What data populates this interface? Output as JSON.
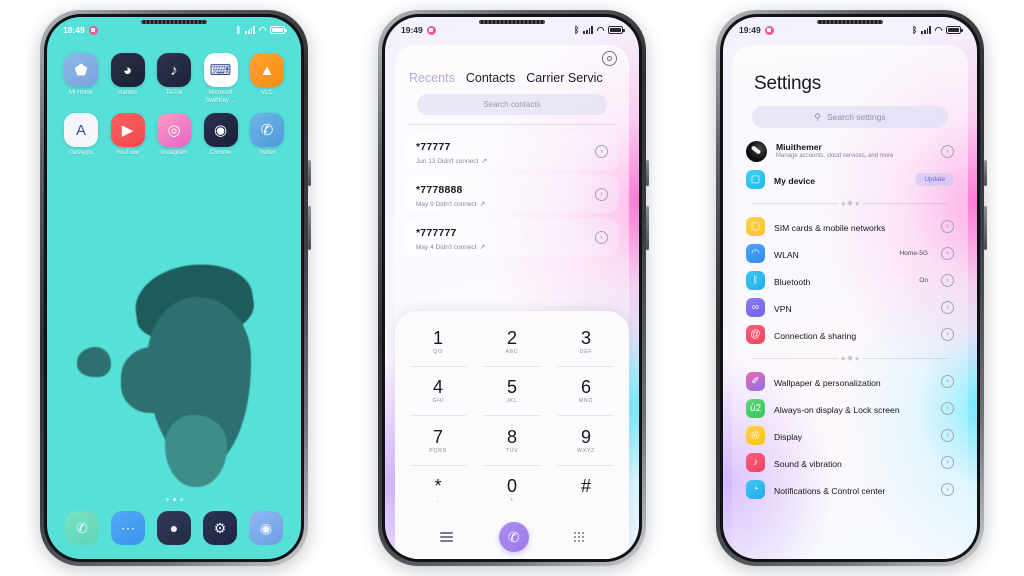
{
  "statusbar": {
    "time": "19:49",
    "icons": [
      "bluetooth-icon",
      "signal-icon",
      "wifi-icon",
      "battery-icon"
    ],
    "bluetooth_glyph": "ᛒ",
    "wifi_glyph": "◠"
  },
  "phone1": {
    "name": "home-screen",
    "wallpaper_color": "#56e0d8",
    "apps_row1": [
      {
        "label": "Mi Home",
        "icon": "mi-home-icon",
        "bg": "linear-gradient(145deg,#8fb8e8,#7aa3dd)",
        "glyph": "⬟"
      },
      {
        "label": "Games",
        "icon": "games-icon",
        "bg": "linear-gradient(145deg,#2c3147,#1b2033)",
        "glyph": "◕"
      },
      {
        "label": "TikTok",
        "icon": "tiktok-icon",
        "bg": "linear-gradient(145deg,#2e3450,#1d2238)",
        "glyph": "♪"
      },
      {
        "label": "Microsoft SwiftKey ...",
        "icon": "swiftkey-icon",
        "bg": "#ffffff",
        "glyph": "⌨"
      },
      {
        "label": "VLC",
        "icon": "vlc-icon",
        "bg": "linear-gradient(145deg,#ffa32e,#f98d16)",
        "glyph": "▲"
      }
    ],
    "apps_row2": [
      {
        "label": "GetApps",
        "icon": "getapps-icon",
        "bg": "#f4f6fb",
        "glyph": "A"
      },
      {
        "label": "YouTube",
        "icon": "youtube-icon",
        "bg": "linear-gradient(145deg,#f9625f,#ef4b4b)",
        "glyph": "▶"
      },
      {
        "label": "Instagram",
        "icon": "instagram-icon",
        "bg": "linear-gradient(145deg,#f9a0c0,#e862c8)",
        "glyph": "◎"
      },
      {
        "label": "Chrome",
        "icon": "chrome-icon",
        "bg": "linear-gradient(145deg,#2b3150,#1a2038)",
        "glyph": "◉"
      },
      {
        "label": "Twitter",
        "icon": "twitter-icon",
        "bg": "linear-gradient(145deg,#6fb4e8,#4e9ad9)",
        "glyph": "✆"
      }
    ],
    "page_dots": {
      "count": 3,
      "active_index": 1
    },
    "dock": [
      {
        "icon": "phone-dock-icon",
        "bg": "linear-gradient(145deg,#7ae2c4,#5fd4b5)",
        "glyph": "✆"
      },
      {
        "icon": "messages-dock-icon",
        "bg": "linear-gradient(145deg,#55a8f5,#3a93ec)",
        "glyph": "⋯"
      },
      {
        "icon": "camera-dock-icon",
        "bg": "linear-gradient(145deg,#333a58,#242a44)",
        "glyph": "●"
      },
      {
        "icon": "settings-dock-icon",
        "bg": "linear-gradient(145deg,#2c3353,#1e2440)",
        "glyph": "⚙"
      },
      {
        "icon": "browser-dock-icon",
        "bg": "linear-gradient(145deg,#8fb8f0,#6f9ee4)",
        "glyph": "◉"
      }
    ]
  },
  "phone2": {
    "name": "dialer-screen",
    "tabs": [
      {
        "label": "Recents",
        "active": true
      },
      {
        "label": "Contacts",
        "active": false
      },
      {
        "label": "Carrier Servic",
        "active": false
      }
    ],
    "search_placeholder": "Search contacts",
    "top_icon": "target-icon",
    "calls": [
      {
        "number": "*77777",
        "detail": "Jun 13 Didn't connect",
        "direction": "outgoing"
      },
      {
        "number": "*7778888",
        "detail": "May 9 Didn't connect",
        "direction": "outgoing"
      },
      {
        "number": "*777777",
        "detail": "May 4 Didn't connect",
        "direction": "outgoing"
      }
    ],
    "keypad": [
      {
        "num": "1",
        "letters": "QO"
      },
      {
        "num": "2",
        "letters": "ABC"
      },
      {
        "num": "3",
        "letters": "DEF"
      },
      {
        "num": "4",
        "letters": "GHI"
      },
      {
        "num": "5",
        "letters": "JKL"
      },
      {
        "num": "6",
        "letters": "MNO"
      },
      {
        "num": "7",
        "letters": "PQRS"
      },
      {
        "num": "8",
        "letters": "TUV"
      },
      {
        "num": "9",
        "letters": "WXYZ"
      },
      {
        "num": "*",
        "letters": ","
      },
      {
        "num": "0",
        "letters": "+"
      },
      {
        "num": "#",
        "letters": ""
      }
    ],
    "bottom_bar": {
      "menu_icon": "menu-icon",
      "call_icon": "call-icon",
      "call_glyph": "✆",
      "keypad_icon": "keypad-icon",
      "call_button_color": "#a184ec"
    }
  },
  "phone3": {
    "name": "settings-screen",
    "title": "Settings",
    "search_placeholder": "Search settings",
    "account": {
      "name": "Miuithemer",
      "subtitle": "Manage accounts, cloud services, and more",
      "avatar": "account-avatar"
    },
    "device": {
      "label": "My device",
      "badge": "Update",
      "icon": "device-icon",
      "bg": "linear-gradient(145deg,#3fd2f5,#21b8e8)",
      "glyph": "▢"
    },
    "group1": [
      {
        "label": "SIM cards & mobile networks",
        "value": "",
        "icon": "sim-icon",
        "bg": "linear-gradient(145deg,#ffd24a,#fbc02d)",
        "glyph": "▢"
      },
      {
        "label": "WLAN",
        "value": "Home-5G",
        "icon": "wlan-icon",
        "bg": "linear-gradient(145deg,#4fa3f7,#2e8ce8)",
        "glyph": "◠"
      },
      {
        "label": "Bluetooth",
        "value": "On",
        "icon": "bluetooth-icon",
        "bg": "linear-gradient(145deg,#3fc6f5,#1fb0e8)",
        "glyph": "ᛒ"
      },
      {
        "label": "VPN",
        "value": "",
        "icon": "vpn-icon",
        "bg": "linear-gradient(145deg,#8a7ef0,#6f62e6)",
        "glyph": "∞"
      },
      {
        "label": "Connection & sharing",
        "value": "",
        "icon": "connection-icon",
        "bg": "linear-gradient(145deg,#fb5f7a,#f0445f)",
        "glyph": "@"
      }
    ],
    "group2": [
      {
        "label": "Wallpaper & personalization",
        "value": "",
        "icon": "wallpaper-icon",
        "bg": "linear-gradient(145deg,#f06aa8,#8a6ef0)",
        "glyph": "✐"
      },
      {
        "label": "Always-on display & Lock screen",
        "value": "",
        "icon": "lock-icon",
        "bg": "linear-gradient(145deg,#5fd87a,#38c45c)",
        "glyph": "ὑ2"
      },
      {
        "label": "Display",
        "value": "",
        "icon": "display-icon",
        "bg": "linear-gradient(145deg,#ffd24a,#f9bf22)",
        "glyph": "◎"
      },
      {
        "label": "Sound & vibration",
        "value": "",
        "icon": "sound-icon",
        "bg": "linear-gradient(145deg,#fb5f7a,#ef4060)",
        "glyph": "♪"
      },
      {
        "label": "Notifications & Control center",
        "value": "",
        "icon": "notifications-icon",
        "bg": "linear-gradient(145deg,#3fc6f5,#1fadea)",
        "glyph": "◔"
      }
    ],
    "chevron_glyph": "›"
  }
}
